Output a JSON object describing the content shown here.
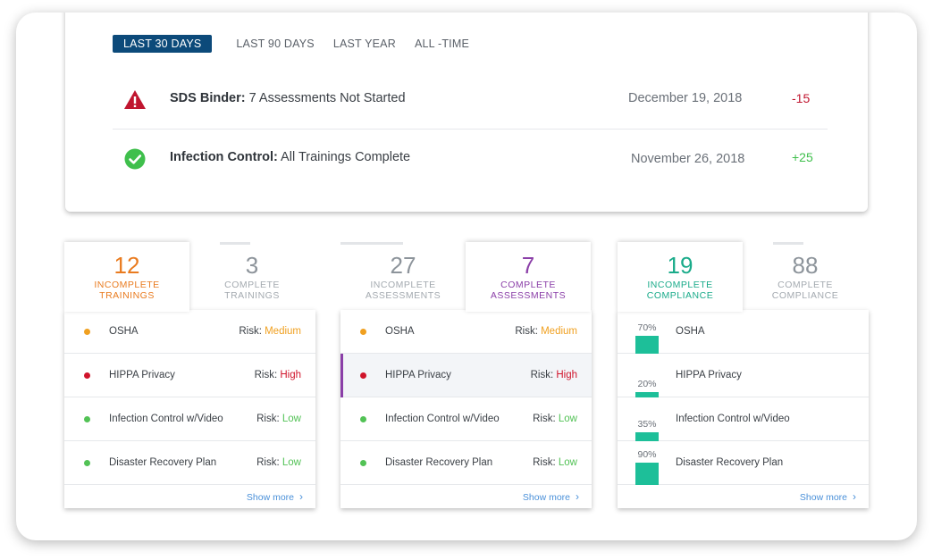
{
  "period_tabs": [
    "LAST 30 DAYS",
    "LAST 90 DAYS",
    "LAST YEAR",
    "ALL -TIME"
  ],
  "activity": [
    {
      "title": "SDS Binder:",
      "text": " 7 Assessments Not Started",
      "date": "December 19, 2018",
      "delta": "-15",
      "icon": "warning-icon",
      "delta_color": "#c0152f"
    },
    {
      "title": "Infection Control:",
      "text": " All Trainings Complete",
      "date": "November 26, 2018",
      "delta": "+25",
      "icon": "check-circle-icon",
      "delta_color": "#3fbf4c"
    }
  ],
  "colors": {
    "orange": "#e97b1f",
    "purple": "#8b3fa8",
    "teal": "#1aab8a",
    "gray": "#8d949b",
    "medium": "#f0a020",
    "high": "#d0142b",
    "low": "#52c255",
    "bar": "#1dbf99"
  },
  "risk_prefix": "Risk:",
  "show_more": "Show more",
  "trainings": {
    "tabs": [
      {
        "num": "12",
        "label": "INCOMPLETE\nTRAININGS",
        "active": true
      },
      {
        "num": "3",
        "label": "COMPLETE\nTRAININGS",
        "active": false
      }
    ],
    "items": [
      {
        "name": "OSHA",
        "risk": "Medium"
      },
      {
        "name": "HIPPA Privacy",
        "risk": "High"
      },
      {
        "name": "Infection Control w/Video",
        "risk": "Low"
      },
      {
        "name": "Disaster Recovery Plan",
        "risk": "Low"
      }
    ]
  },
  "assessments": {
    "tabs": [
      {
        "num": "27",
        "label": "INCOMPLETE\nASSESSMENTS",
        "active": false
      },
      {
        "num": "7",
        "label": "COMPLETE\nASSESSMENTS",
        "active": true
      }
    ],
    "items": [
      {
        "name": "OSHA",
        "risk": "Medium"
      },
      {
        "name": "HIPPA Privacy",
        "risk": "High"
      },
      {
        "name": "Infection Control w/Video",
        "risk": "Low"
      },
      {
        "name": "Disaster Recovery Plan",
        "risk": "Low"
      }
    ]
  },
  "compliance": {
    "tabs": [
      {
        "num": "19",
        "label": "INCOMPLETE\nCOMPLIANCE",
        "active": true
      },
      {
        "num": "88",
        "label": "COMPLETE\nCOMPLIANCE",
        "active": false
      }
    ],
    "items": [
      {
        "name": "OSHA",
        "percent": "70%",
        "fraction": 0.7
      },
      {
        "name": "HIPPA Privacy",
        "percent": "20%",
        "fraction": 0.2
      },
      {
        "name": "Infection Control w/Video",
        "percent": "35%",
        "fraction": 0.35
      },
      {
        "name": "Disaster Recovery Plan",
        "percent": "90%",
        "fraction": 0.9
      }
    ]
  }
}
